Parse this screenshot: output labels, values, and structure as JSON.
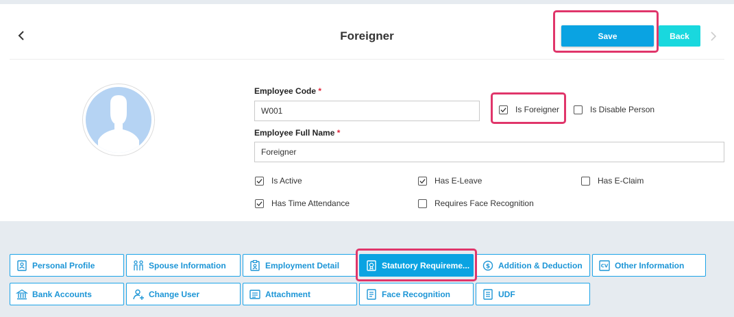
{
  "header": {
    "title": "Foreigner",
    "save_label": "Save",
    "back_label": "Back"
  },
  "form": {
    "employee_code_label": "Employee Code",
    "employee_code_value": "W001",
    "full_name_label": "Employee Full Name",
    "full_name_value": "Foreigner",
    "required_mark": "*",
    "is_foreigner": {
      "label": "Is Foreigner",
      "checked": true
    },
    "is_disable_person": {
      "label": "Is Disable Person",
      "checked": false
    },
    "is_active": {
      "label": "Is Active",
      "checked": true
    },
    "has_e_leave": {
      "label": "Has E-Leave",
      "checked": true
    },
    "has_e_claim": {
      "label": "Has E-Claim",
      "checked": false
    },
    "has_time_attendance": {
      "label": "Has Time Attendance",
      "checked": true
    },
    "requires_face_recognition": {
      "label": "Requires Face Recognition",
      "checked": false
    }
  },
  "tabs": [
    {
      "label": "Personal Profile",
      "icon": "profile-card-icon"
    },
    {
      "label": "Spouse Information",
      "icon": "couple-icon"
    },
    {
      "label": "Employment Detail",
      "icon": "clipboard-user-icon"
    },
    {
      "label": "Statutory Requireme...",
      "icon": "document-badge-icon",
      "active": true
    },
    {
      "label": "Addition & Deduction",
      "icon": "money-cycle-icon"
    },
    {
      "label": "Other Information",
      "icon": "cv-icon"
    },
    {
      "label": "Bank Accounts",
      "icon": "bank-icon"
    },
    {
      "label": "Change User",
      "icon": "user-plus-icon"
    },
    {
      "label": "Attachment",
      "icon": "attachment-icon"
    },
    {
      "label": "Face Recognition",
      "icon": "face-id-icon"
    },
    {
      "label": "UDF",
      "icon": "udf-icon"
    }
  ],
  "colors": {
    "accent": "#0aa3e2",
    "back_button": "#19d8de",
    "highlight": "#e0356a",
    "avatar": "#b5d3f3"
  }
}
